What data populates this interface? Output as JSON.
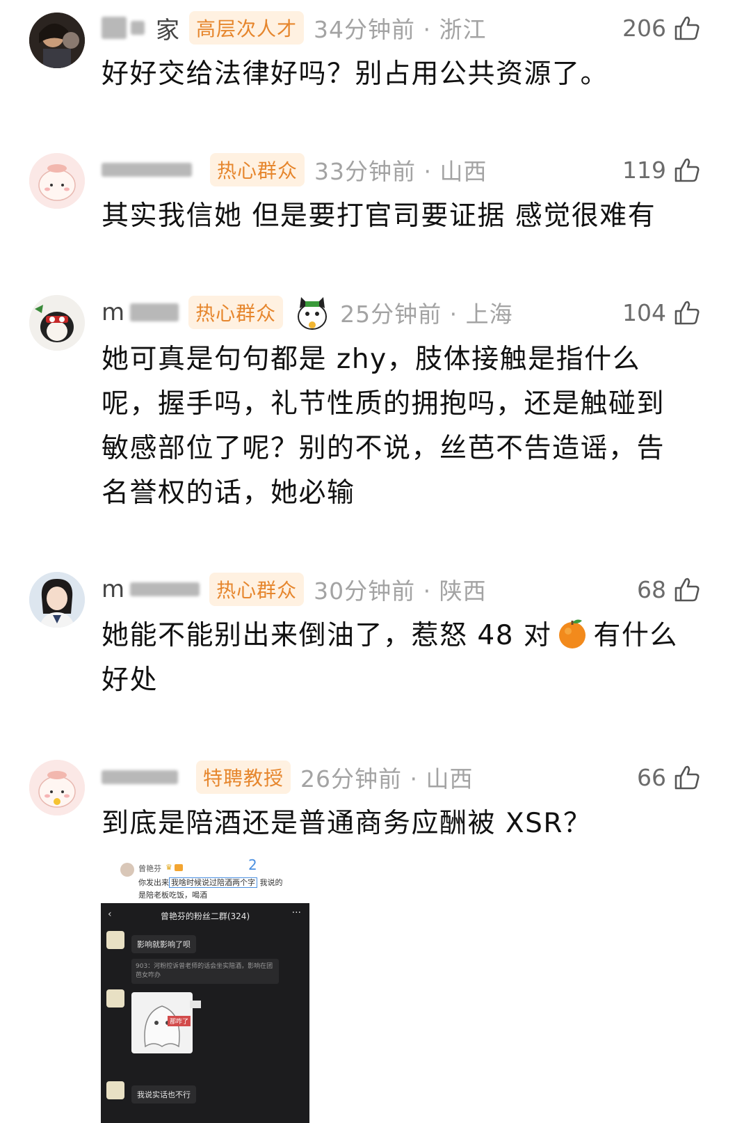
{
  "comments": [
    {
      "username": "家",
      "badge": "高层次人才",
      "time_location": "34分钟前 · 浙江",
      "likes": "206",
      "text": "好好交给法律好吗？别占用公共资源了。"
    },
    {
      "username": "",
      "badge": "热心群众",
      "time_location": "33分钟前 · 山西",
      "likes": "119",
      "text": "其实我信她 但是要打官司要证据 感觉很难有"
    },
    {
      "username": "m",
      "badge": "热心群众",
      "time_location": "25分钟前 · 上海",
      "likes": "104",
      "text_lines": [
        "她可真是句句都是 zhy，肢体接触是指什么",
        "呢，握手吗，礼节性质的拥抱吗，还是触碰到",
        "敏感部位了呢？别的不说，丝芭不告造谣，告",
        "名誉权的话，她必输"
      ]
    },
    {
      "username": "m",
      "badge": "热心群众",
      "time_location": "30分钟前 · 陕西",
      "likes": "68",
      "text_part1": "她能不能别出来倒油了，惹怒 48 对",
      "text_part2": "有什么",
      "text_line2": "好处"
    },
    {
      "username": "",
      "badge": "特聘教授",
      "time_location": "26分钟前 · 山西",
      "likes": "66",
      "text": "到底是陪酒还是普通商务应酬被 XSR？"
    }
  ],
  "embed": {
    "name": "曾艳芬",
    "annotation_number": "2",
    "line1_pre": "你发出来",
    "line1_box": "我啥时候说过陪酒两个字",
    "line1_post": "我说的",
    "line2": "是陪老板吃饭，喝酒",
    "phone_title": "曾艳芬的粉丝二群(324)",
    "msg1": "影响就影响了呗",
    "quote": "903：河粉控诉曾老师的话会坐实陪酒，影响在团芭女咋办",
    "sticker_label": "那咋了",
    "msg3": "我说实话也不行"
  },
  "colors": {
    "badge_orange": "#e6862d",
    "badge_bg": "#fff1e1",
    "meta_gray": "#a3a3a3",
    "annotation_blue": "#4a8fe0"
  }
}
